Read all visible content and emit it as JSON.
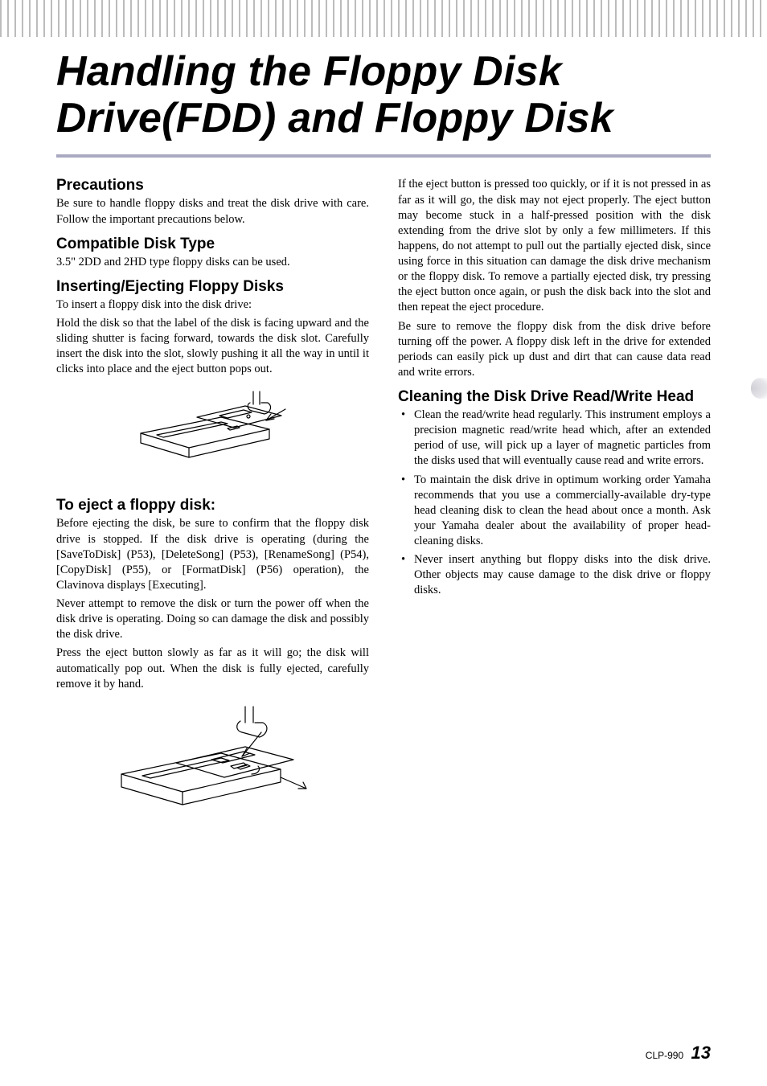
{
  "title": "Handling the Floppy Disk Drive(FDD) and Floppy Disk",
  "left": {
    "precautions_h": "Precautions",
    "precautions_p": "Be sure to handle floppy disks and treat the disk drive with care. Follow the important precautions below.",
    "compat_h": "Compatible Disk Type",
    "compat_p": "3.5\" 2DD and 2HD type floppy disks can be used.",
    "insert_h": "Inserting/Ejecting Floppy Disks",
    "insert_p1": "To insert a floppy disk into the disk drive:",
    "insert_p2": "Hold the disk so that the label of the disk is facing upward and the sliding shutter is facing forward, towards the disk slot. Carefully insert the disk into the slot, slowly pushing it all the way in until it clicks into place and the eject button pops out.",
    "eject_h": "To eject a floppy disk:",
    "eject_p1": "Before ejecting the disk, be sure to confirm that the floppy disk drive is stopped. If the disk drive is operating (during the [SaveToDisk] (P53), [DeleteSong] (P53), [RenameSong] (P54), [CopyDisk] (P55), or [FormatDisk] (P56) operation), the Clavinova displays [Executing].",
    "eject_p2": "Never attempt to remove the disk or turn the power off when the disk drive is operating. Doing so can damage the disk and possibly the disk drive.",
    "eject_p3": "Press the eject button slowly as far as it will go; the disk will automatically pop out. When the disk is fully ejected, carefully remove it by hand."
  },
  "right": {
    "cont_p1": "If the eject button is pressed too quickly, or if it is not pressed in as far as it will go, the disk may not eject properly. The eject button may become stuck in a half-pressed position with the disk extending from the drive slot by only a few millimeters. If this happens, do not attempt to pull out the partially ejected disk, since using force in this situation can damage the disk drive mechanism or the floppy disk. To remove a partially ejected disk, try pressing the eject button once again, or push the disk back into the slot and then repeat the eject procedure.",
    "cont_p2": "Be sure to remove the floppy disk from the disk drive before turning off the power. A floppy disk left in the drive for extended periods can easily pick up dust and dirt that can cause data read and write errors.",
    "clean_h": "Cleaning the Disk Drive Read/Write Head",
    "clean_b1": "Clean the read/write head regularly. This instrument employs a precision magnetic read/write head which, after an extended period of use, will pick up a layer of magnetic particles from the disks used that will eventually cause read and write errors.",
    "clean_b2": "To maintain the disk drive in optimum working order Yamaha recommends that you use a commercially-available dry-type head cleaning disk to clean the head about once a month. Ask your Yamaha dealer about the availability of proper head-cleaning disks.",
    "clean_b3": "Never insert anything but floppy disks into the disk drive. Other objects may cause damage to the disk drive or floppy disks."
  },
  "footer": {
    "model": "CLP-990",
    "page": "13"
  }
}
